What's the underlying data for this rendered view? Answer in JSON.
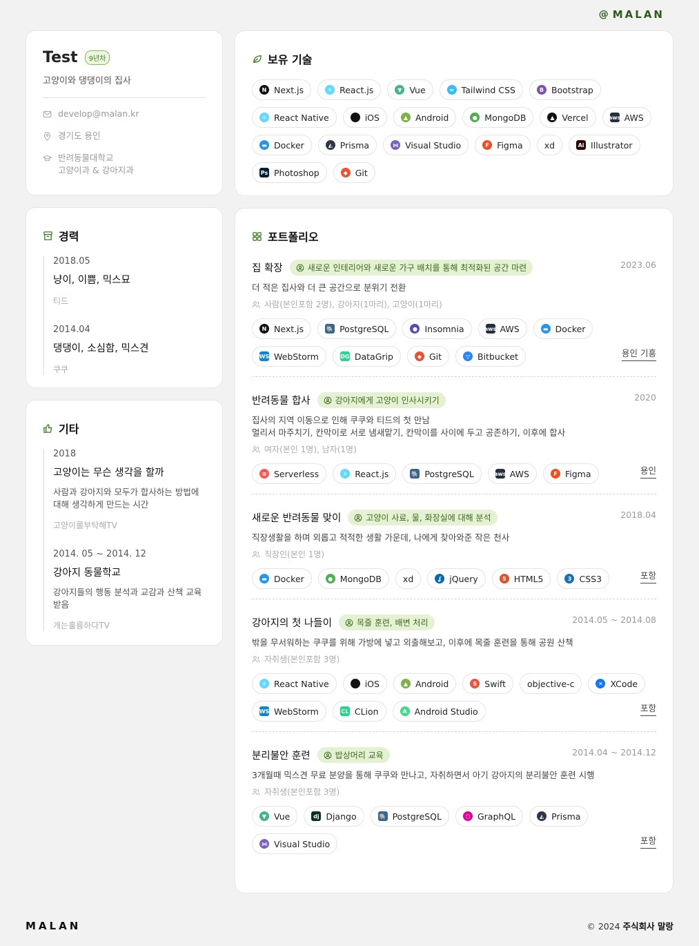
{
  "header": {
    "at": "@",
    "logo": "MALAN"
  },
  "profile": {
    "name": "Test",
    "years": "9년차",
    "tagline": "고양이와 댕댕이의 집사",
    "email": "develop@malan.kr",
    "location": "경기도 용인",
    "school": "반려동물대학교",
    "major": "고양이과 & 강아지과"
  },
  "career": {
    "title": "경력",
    "items": [
      {
        "date": "2018.05",
        "title": "냥이, 이쁨, 믹스묘",
        "sub": "티드"
      },
      {
        "date": "2014.04",
        "title": "댕댕이, 소심함, 믹스견",
        "sub": "쿠쿠"
      }
    ]
  },
  "etc": {
    "title": "기타",
    "items": [
      {
        "date": "2018",
        "title": "고양이는 무슨 생각을 할까",
        "desc": "사람과 강아지와 모두가 합사하는 방법에 대해 생각하게 만드는 시간",
        "sub": "고양이를부탁해TV"
      },
      {
        "date": "2014. 05 ~ 2014. 12",
        "title": "강아지 동물학교",
        "desc": "강아지들의 행동 분석과 교감과 산책 교육 받음",
        "sub": "개는훌륭하다TV"
      }
    ]
  },
  "skills": {
    "title": "보유 기술",
    "items": [
      {
        "label": "Next.js",
        "icon": "nextjs-icon",
        "color": "#111111",
        "glyph": "N"
      },
      {
        "label": "React.js",
        "icon": "react-icon",
        "color": "#61dafb",
        "glyph": "⚛"
      },
      {
        "label": "Vue",
        "icon": "vue-icon",
        "color": "#41b883",
        "glyph": "▼"
      },
      {
        "label": "Tailwind CSS",
        "icon": "tailwind-icon",
        "color": "#38bdf8",
        "glyph": "≈"
      },
      {
        "label": "Bootstrap",
        "icon": "bootstrap-icon",
        "color": "#7952b3",
        "glyph": "B"
      },
      {
        "label": "React Native",
        "icon": "react-native-icon",
        "color": "#61dafb",
        "glyph": "⚛"
      },
      {
        "label": "iOS",
        "icon": "apple-icon",
        "color": "#111111",
        "glyph": ""
      },
      {
        "label": "Android",
        "icon": "android-icon",
        "color": "#7cb342",
        "glyph": "▲"
      },
      {
        "label": "MongoDB",
        "icon": "mongodb-icon",
        "color": "#4caf50",
        "glyph": "●"
      },
      {
        "label": "Vercel",
        "icon": "vercel-icon",
        "color": "#111111",
        "glyph": "▲"
      },
      {
        "label": "AWS",
        "icon": "aws-icon",
        "color": "#232f3e",
        "glyph": "aws"
      },
      {
        "label": "Docker",
        "icon": "docker-icon",
        "color": "#2496ed",
        "glyph": "▬"
      },
      {
        "label": "Prisma",
        "icon": "prisma-icon",
        "color": "#2d3748",
        "glyph": "◭"
      },
      {
        "label": "Visual Studio",
        "icon": "visual-studio-icon",
        "color": "#7b61c2",
        "glyph": "⋈"
      },
      {
        "label": "Figma",
        "icon": "figma-icon",
        "color": "#f24e1e",
        "glyph": "F"
      },
      {
        "label": "xd",
        "icon": "",
        "color": "",
        "glyph": ""
      },
      {
        "label": "Illustrator",
        "icon": "illustrator-icon",
        "color": "#330000",
        "glyph": "Ai"
      },
      {
        "label": "Photoshop",
        "icon": "photoshop-icon",
        "color": "#001e36",
        "glyph": "Ps"
      },
      {
        "label": "Git",
        "icon": "git-icon",
        "color": "#f05032",
        "glyph": "◆"
      }
    ]
  },
  "portfolio": {
    "title": "포트폴리오",
    "projects": [
      {
        "title": "집 확장",
        "highlight": "새로운 인테리어와 새로운 가구 배치를 통해 최적화된 공간 마련",
        "date": "2023.06",
        "desc": [
          "더 적은 집사와 더 큰 공간으로 분위기 전환"
        ],
        "team": "사람(본인포함 2명), 강아지(1마리), 고양이(1마리)",
        "role": "용인 기흥",
        "stack": [
          {
            "label": "Next.js",
            "icon": "nextjs-icon",
            "color": "#111111",
            "glyph": "N"
          },
          {
            "label": "PostgreSQL",
            "icon": "postgresql-icon",
            "color": "#336791",
            "glyph": "🐘"
          },
          {
            "label": "Insomnia",
            "icon": "insomnia-icon",
            "color": "#5849be",
            "glyph": "●"
          },
          {
            "label": "AWS",
            "icon": "aws-icon",
            "color": "#232f3e",
            "glyph": "aws"
          },
          {
            "label": "Docker",
            "icon": "docker-icon",
            "color": "#2496ed",
            "glyph": "▬"
          },
          {
            "label": "WebStorm",
            "icon": "webstorm-icon",
            "color": "#0a86d9",
            "glyph": "WS"
          },
          {
            "label": "DataGrip",
            "icon": "datagrip-icon",
            "color": "#22d88f",
            "glyph": "DG"
          },
          {
            "label": "Git",
            "icon": "git-icon",
            "color": "#f05032",
            "glyph": "◆"
          },
          {
            "label": "Bitbucket",
            "icon": "bitbucket-icon",
            "color": "#2684ff",
            "glyph": "▽"
          }
        ]
      },
      {
        "title": "반려동물 합사",
        "highlight": "강아지에게 고양이 인사시키기",
        "date": "2020",
        "desc": [
          "집사의 지역 이동으로 인해 쿠쿠와 티드의 첫 만남",
          "멀리서 마주치기, 칸막이로 서로 냄새맡기, 칸막이를 사이에 두고 공존하기, 이후에 합사"
        ],
        "team": "여자(본인 1명), 남자(1명)",
        "role": "용인",
        "stack": [
          {
            "label": "Serverless",
            "icon": "serverless-icon",
            "color": "#fd5750",
            "glyph": "≡"
          },
          {
            "label": "React.js",
            "icon": "react-icon",
            "color": "#61dafb",
            "glyph": "⚛"
          },
          {
            "label": "PostgreSQL",
            "icon": "postgresql-icon",
            "color": "#336791",
            "glyph": "🐘"
          },
          {
            "label": "AWS",
            "icon": "aws-icon",
            "color": "#232f3e",
            "glyph": "aws"
          },
          {
            "label": "Figma",
            "icon": "figma-icon",
            "color": "#f24e1e",
            "glyph": "F"
          }
        ]
      },
      {
        "title": "새로운 반려동물 맞이",
        "highlight": "고양이 사료, 물, 화장실에 대해 분석",
        "date": "2018.04",
        "desc": [
          "직장생활을 하며 외롭고 적적한 생활 가운데, 나에게 찾아와준 작은 천사"
        ],
        "team": "직장인(본인 1명)",
        "role": "포항",
        "stack": [
          {
            "label": "Docker",
            "icon": "docker-icon",
            "color": "#2496ed",
            "glyph": "▬"
          },
          {
            "label": "MongoDB",
            "icon": "mongodb-icon",
            "color": "#4caf50",
            "glyph": "●"
          },
          {
            "label": "xd",
            "icon": "",
            "color": "",
            "glyph": ""
          },
          {
            "label": "jQuery",
            "icon": "jquery-icon",
            "color": "#0769ad",
            "glyph": "ʆ"
          },
          {
            "label": "HTML5",
            "icon": "html5-icon",
            "color": "#e34f26",
            "glyph": "5"
          },
          {
            "label": "CSS3",
            "icon": "css3-icon",
            "color": "#1572b6",
            "glyph": "3"
          }
        ]
      },
      {
        "title": "강아지의 첫 나들이",
        "highlight": "목줄 훈련, 배변 처리",
        "date": "2014.05 ~ 2014.08",
        "desc": [
          "밖을 무서워하는 쿠쿠를 위해 가방에 넣고 외출해보고, 이후에 목줄 훈련을 통해 공원 산책"
        ],
        "team": "자취생(본인포함 3명)",
        "role": "포항",
        "stack": [
          {
            "label": "React Native",
            "icon": "react-native-icon",
            "color": "#61dafb",
            "glyph": "⚛"
          },
          {
            "label": "iOS",
            "icon": "apple-icon",
            "color": "#111111",
            "glyph": ""
          },
          {
            "label": "Android",
            "icon": "android-icon",
            "color": "#7cb342",
            "glyph": "▲"
          },
          {
            "label": "Swift",
            "icon": "swift-icon",
            "color": "#f05138",
            "glyph": "S"
          },
          {
            "label": "objective-c",
            "icon": "",
            "color": "",
            "glyph": ""
          },
          {
            "label": "XCode",
            "icon": "xcode-icon",
            "color": "#1575f9",
            "glyph": "✕"
          },
          {
            "label": "WebStorm",
            "icon": "webstorm-icon",
            "color": "#0a86d9",
            "glyph": "WS"
          },
          {
            "label": "CLion",
            "icon": "clion-icon",
            "color": "#21d789",
            "glyph": "CL"
          },
          {
            "label": "Android Studio",
            "icon": "android-studio-icon",
            "color": "#3ddc84",
            "glyph": "A"
          }
        ]
      },
      {
        "title": "분리불안 훈련",
        "highlight": "밥상머리 교육",
        "date": "2014.04 ~ 2014.12",
        "desc": [
          "3개월때 믹스견 무료 분양을 통해 쿠쿠와 만나고, 자취하면서 아기 강아지의 분리불안 훈련 시행"
        ],
        "team": "자취생(본인포함 3명)",
        "role": "포항",
        "stack": [
          {
            "label": "Vue",
            "icon": "vue-icon",
            "color": "#41b883",
            "glyph": "▼"
          },
          {
            "label": "Django",
            "icon": "django-icon",
            "color": "#092e20",
            "glyph": "dj"
          },
          {
            "label": "PostgreSQL",
            "icon": "postgresql-icon",
            "color": "#336791",
            "glyph": "🐘"
          },
          {
            "label": "GraphQL",
            "icon": "graphql-icon",
            "color": "#e10098",
            "glyph": "⬡"
          },
          {
            "label": "Prisma",
            "icon": "prisma-icon",
            "color": "#2d3748",
            "glyph": "◭"
          },
          {
            "label": "Visual Studio",
            "icon": "visual-studio-icon",
            "color": "#7b61c2",
            "glyph": "⋈"
          }
        ]
      }
    ]
  },
  "footer": {
    "logo": "MALAN",
    "copyright": "© 2024",
    "company": "주식회사 말랑"
  }
}
